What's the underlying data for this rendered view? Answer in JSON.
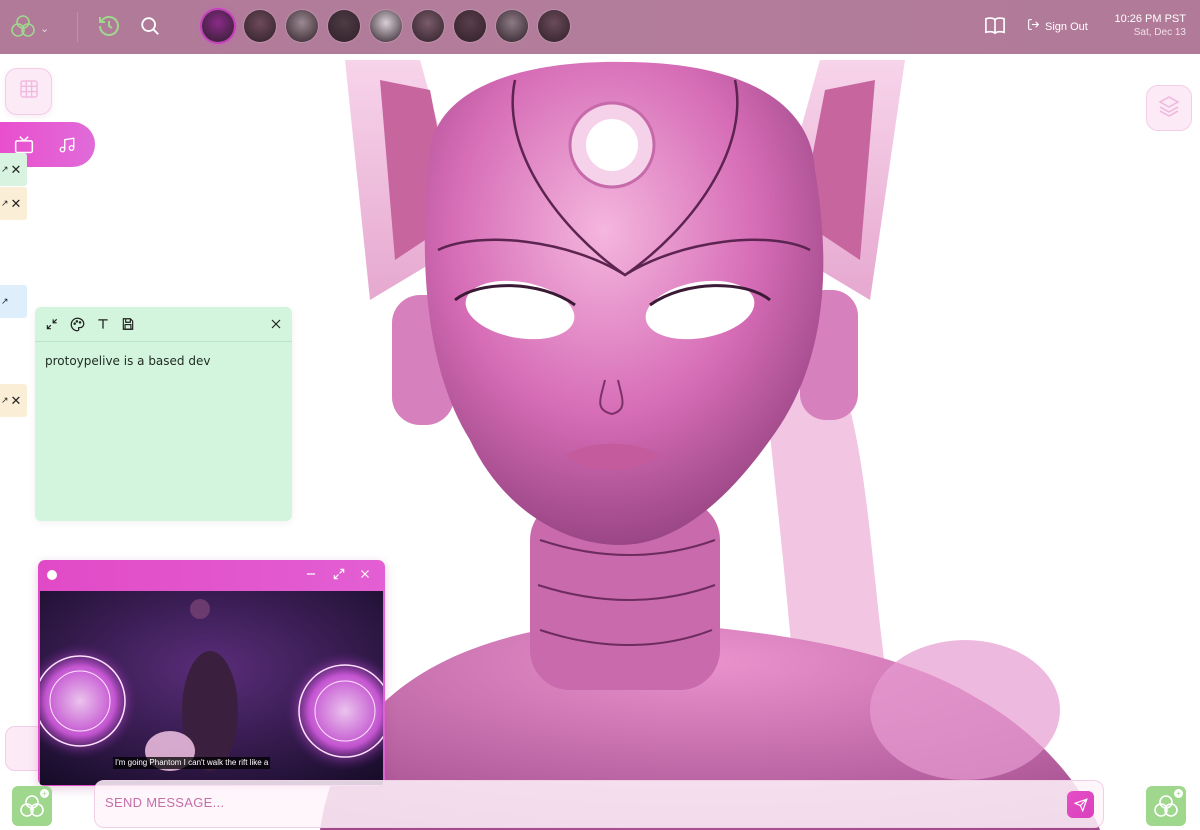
{
  "topbar": {
    "avatars": [
      {
        "name": "active-persona",
        "color": "#8a2a8a",
        "active": true
      },
      {
        "name": "persona-2",
        "color": "#6e4a5a"
      },
      {
        "name": "persona-3",
        "color": "#9c8a92"
      },
      {
        "name": "persona-4",
        "color": "#4f3c45"
      },
      {
        "name": "persona-5",
        "color": "#d9cfd6"
      },
      {
        "name": "persona-6",
        "color": "#7a5b6a"
      },
      {
        "name": "persona-7",
        "color": "#5b3e4c"
      },
      {
        "name": "persona-8",
        "color": "#8d7b84"
      },
      {
        "name": "persona-9",
        "color": "#6b4b59"
      }
    ],
    "signout_label": "Sign Out",
    "time": "10:26 PM PST",
    "date": "Sat, Dec 13"
  },
  "note": {
    "text": "protoypelive is a based dev"
  },
  "video": {
    "caption": "I'm going Phantom I can't walk the rift like a"
  },
  "message": {
    "placeholder": "SEND MESSAGE..."
  },
  "colors": {
    "topbar": "#b07a98",
    "accent": "#e14ac6",
    "note": "#d3f5dd",
    "logo_green": "#9fd78d"
  },
  "icons": [
    "logo-icon",
    "history-icon",
    "search-icon",
    "book-icon",
    "sign-out-icon",
    "grid-icon",
    "tv-icon",
    "music-icon",
    "layers-icon",
    "collapse-icon",
    "palette-icon",
    "text-icon",
    "save-icon",
    "close-icon",
    "minimize-icon",
    "expand-icon",
    "send-icon"
  ]
}
